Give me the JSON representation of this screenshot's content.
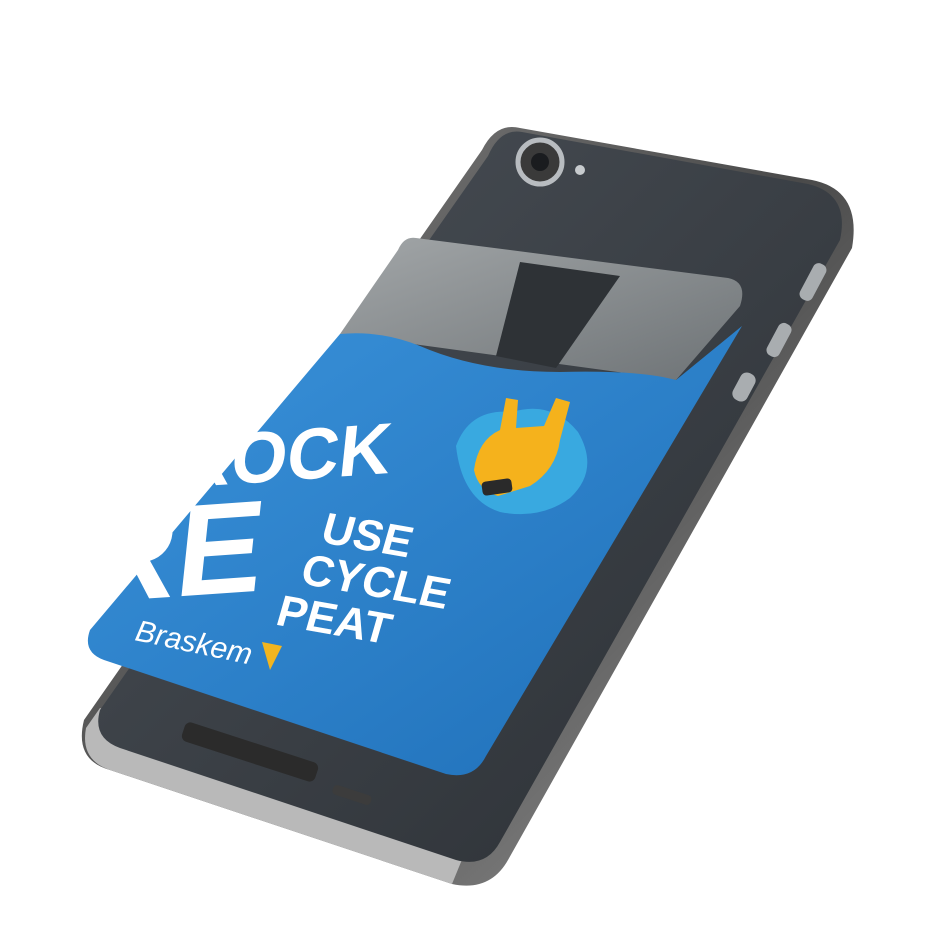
{
  "image": {
    "background": "#ffffff",
    "subject": "phone"
  },
  "colors": {
    "phone_frame": "#5b5b5b",
    "phone_glass": "#3a3f45",
    "wallet_blue": "#2f86cf",
    "card_gray": "#8f9497",
    "print_white": "#ffffff",
    "logo_yellow": "#f2b51f"
  },
  "wallet_print": {
    "word_rock": "ROCK",
    "word_re": "RE",
    "suffix_1": "USE",
    "suffix_2": "CYCLE",
    "suffix_3": "PEAT",
    "logo": "Braskem"
  },
  "icons": {
    "hand": "rock-hand-icon",
    "camera": "camera-lens-icon",
    "logo_mark": "braskem-logo-mark"
  }
}
